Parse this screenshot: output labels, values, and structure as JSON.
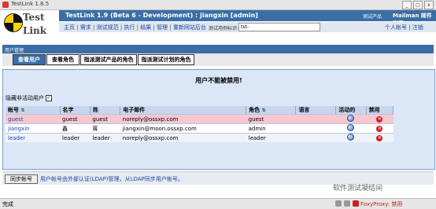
{
  "window": {
    "title": "TestLink 1.8.5"
  },
  "header": {
    "logo_line1": "Test",
    "logo_line2": "Link",
    "app_title": "TestLink 1.9 (Beta 6 - Development) : jiangxin [admin]",
    "product_label": "测试产品",
    "product_value": "Mailman 邮件列表",
    "nav": [
      "主页",
      "需求",
      "测试规范",
      "执行",
      "结果",
      "管理",
      "重新网站后台"
    ],
    "search_label": "测试用例标识:",
    "search_value": "tst-",
    "right_links": "个人帐号 | 注销"
  },
  "section": {
    "title": "用户管理"
  },
  "tabs": [
    "查看用户",
    "查看角色",
    "指派测试产品的角色",
    "指派测试计划的角色"
  ],
  "message": "用户不能被禁用!",
  "hide_inactive_label": "隐藏非活动用户",
  "table": {
    "headers": [
      "帐号",
      "名字",
      "姓",
      "电子邮件",
      "角色",
      "语言",
      "活动的",
      "禁用"
    ],
    "rows": [
      {
        "login": "guest",
        "first": "guest",
        "last": "guest",
        "email": "noreply@ossxp.com",
        "role": "guest",
        "lang": ""
      },
      {
        "login": "jiangxin",
        "first": "鑫",
        "last": "蒋",
        "email": "jiangxin@moon.ossxp.com",
        "role": "admin",
        "lang": ""
      },
      {
        "login": "leader",
        "first": "leader",
        "last": "leader",
        "email": "noreply@ossxp.com",
        "role": "leader",
        "lang": ""
      }
    ]
  },
  "ldap": {
    "button": "同步帐号",
    "text": "用户帐号由外部认证(LDAP)管理，从LDAP同步用户帐号。"
  },
  "status": {
    "done": "完成",
    "foxy": "FoxyProxy: 禁用"
  },
  "watermark": "软件测试凝结间"
}
